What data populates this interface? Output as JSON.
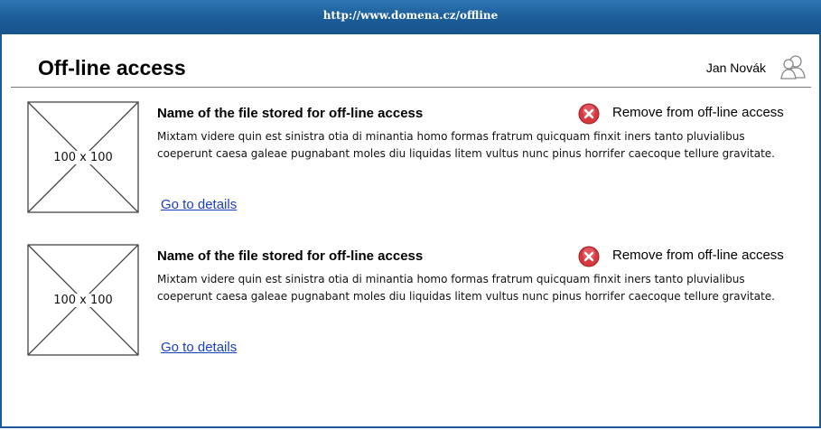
{
  "browser": {
    "url": "http://www.domena.cz/offline"
  },
  "header": {
    "title": "Off-line access",
    "user_name": "Jan Novák"
  },
  "items": [
    {
      "thumbnail_label": "100 x 100",
      "file_name": "Name of the file stored for off-line access",
      "remove_label": "Remove from off-line access",
      "description": "Mixtam videre quin est sinistra otia di minantia homo formas fratrum quicquam finxit iners tanto pluvialibus coeperunt caesa galeae pugnabant moles diu liquidas litem vultus nunc pinus horrifer caecoque tellure gravitate.",
      "details_link": "Go to details"
    },
    {
      "thumbnail_label": "100 x 100",
      "file_name": "Name of the file stored for off-line access",
      "remove_label": "Remove from off-line access",
      "description": "Mixtam videre quin est sinistra otia di minantia homo formas fratrum quicquam finxit iners tanto pluvialibus coeperunt caesa galeae pugnabant moles diu liquidas litem vultus nunc pinus horrifer caecoque tellure gravitate.",
      "details_link": "Go to details"
    }
  ],
  "icons": {
    "user": "user-icon",
    "remove": "remove-circle-x-icon",
    "thumbnail": "image-placeholder-icon"
  },
  "colors": {
    "titlebar": "#1c5f9b",
    "link": "#1a3fbf",
    "remove": "#d9363e"
  }
}
